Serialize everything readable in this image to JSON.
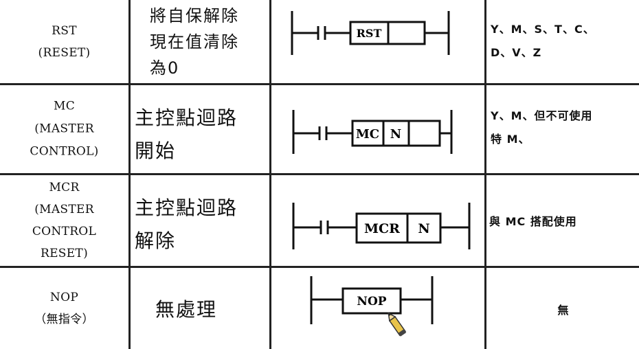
{
  "rows": [
    {
      "instruction": [
        "RST",
        "(RESET)"
      ],
      "function": [
        "將自保解除",
        "現在值清除",
        "為0"
      ],
      "ladder_boxes": [
        "RST"
      ],
      "targets": [
        "Y、M、S、T、C、",
        "D、V、Z"
      ]
    },
    {
      "instruction": [
        "MC",
        "(MASTER",
        "CONTROL)"
      ],
      "function": [
        "主控點迴路",
        "開始"
      ],
      "ladder_boxes": [
        "MC",
        "N"
      ],
      "targets": [
        "Y、M、但不可使用",
        "特 M、"
      ]
    },
    {
      "instruction": [
        "MCR",
        "(MASTER",
        "CONTROL",
        "RESET)"
      ],
      "function": [
        "主控點迴路",
        "解除"
      ],
      "ladder_boxes": [
        "MCR",
        "N"
      ],
      "targets": [
        "與 MC 搭配使用"
      ]
    },
    {
      "instruction": [
        "NOP",
        "（無指令）"
      ],
      "function": [
        "無處理"
      ],
      "ladder_boxes": [
        "NOP"
      ],
      "targets": [
        "無"
      ]
    }
  ]
}
